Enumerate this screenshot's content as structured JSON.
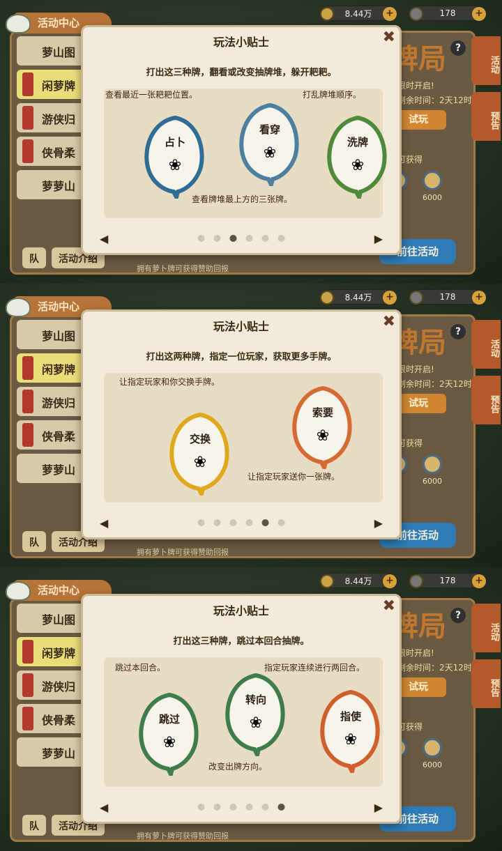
{
  "common": {
    "gold_amount": "8.44万",
    "gem_amount": "178",
    "tab_header": "活动中心",
    "list_items": [
      "萝山图",
      "闲萝牌",
      "游侠归",
      "侠骨柔",
      "萝萝山"
    ],
    "big_title": "牌局",
    "time_open": "限时开启!",
    "time_left": "剩余时间：2天12时",
    "try_button": "试玩",
    "can_get": "可获得",
    "reward_value": "6000",
    "side_tab_activity": "活动",
    "side_tab_notice": "预告",
    "go_activity": "前往活动",
    "team_button": "队",
    "activity_button": "活动介绍",
    "footnote": "拥有萝卜牌可获得赞助回报",
    "help": "?"
  },
  "dialogs": [
    {
      "title": "玩法小贴士",
      "subtitle": "打出这三种牌，翻看或改变抽牌堆，躲开耙耙。",
      "captions": [
        "查看最近一张耙耙位置。",
        "打乱牌堆顺序。",
        "查看牌堆最上方的三张牌。"
      ],
      "cards": [
        {
          "name": "占卜",
          "color": "#2f6d95"
        },
        {
          "name": "看穿",
          "color": "#4d7fa0"
        },
        {
          "name": "洗牌",
          "color": "#4d8a3a"
        }
      ],
      "active_dot": 3
    },
    {
      "title": "玩法小贴士",
      "subtitle": "打出这两种牌，指定一位玩家，获取更多手牌。",
      "captions": [
        "让指定玩家和你交换手牌。",
        "让指定玩家送你一张牌。"
      ],
      "cards": [
        {
          "name": "交换",
          "color": "#e0a81e"
        },
        {
          "name": "索要",
          "color": "#d56a33"
        }
      ],
      "active_dot": 5
    },
    {
      "title": "玩法小贴士",
      "subtitle": "打出这三种牌，跳过本回合抽牌。",
      "captions": [
        "跳过本回合。",
        "指定玩家连续进行两回合。",
        "改变出牌方向。"
      ],
      "cards": [
        {
          "name": "跳过",
          "color": "#3f7d4a"
        },
        {
          "name": "转向",
          "color": "#3f7d4a"
        },
        {
          "name": "指使",
          "color": "#cf5f2c"
        }
      ],
      "active_dot": 6
    }
  ],
  "nav": {
    "prev": "◀",
    "next": "▶",
    "close": "✖"
  }
}
